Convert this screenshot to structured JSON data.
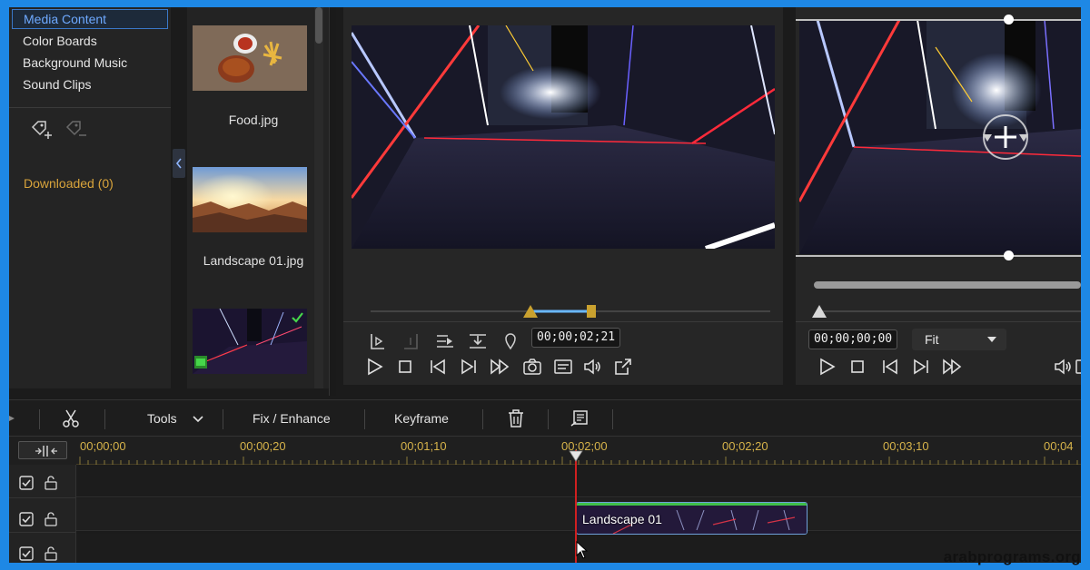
{
  "library": {
    "categories": [
      {
        "label": "Media Content",
        "selected": true
      },
      {
        "label": "Color Boards",
        "selected": false
      },
      {
        "label": "Background Music",
        "selected": false
      },
      {
        "label": "Sound Clips",
        "selected": false
      }
    ],
    "downloaded_label": "Downloaded (0)"
  },
  "media": {
    "items": [
      {
        "label": "Food.jpg"
      },
      {
        "label": "Landscape 01.jpg"
      },
      {
        "label": ""
      }
    ]
  },
  "player1": {
    "timecode": "00;00;02;21"
  },
  "player2": {
    "timecode": "00;00;00;00",
    "zoom_option": "Fit"
  },
  "toolbar": {
    "tools_label": "Tools",
    "fix_enhance_label": "Fix / Enhance",
    "keyframe_label": "Keyframe"
  },
  "timeline": {
    "ticks": [
      "00;00;00",
      "00;00;20",
      "00;01;10",
      "00;02;00",
      "00;02;20",
      "00;03;10",
      "00;04"
    ],
    "clip_label": "Landscape 01"
  },
  "watermark": "arabprograms.org",
  "colors": {
    "accent_blue": "#3a78c8",
    "timecode_gold": "#d6b34a",
    "downloaded_gold": "#d9a43b",
    "playhead_red": "#d02020"
  }
}
